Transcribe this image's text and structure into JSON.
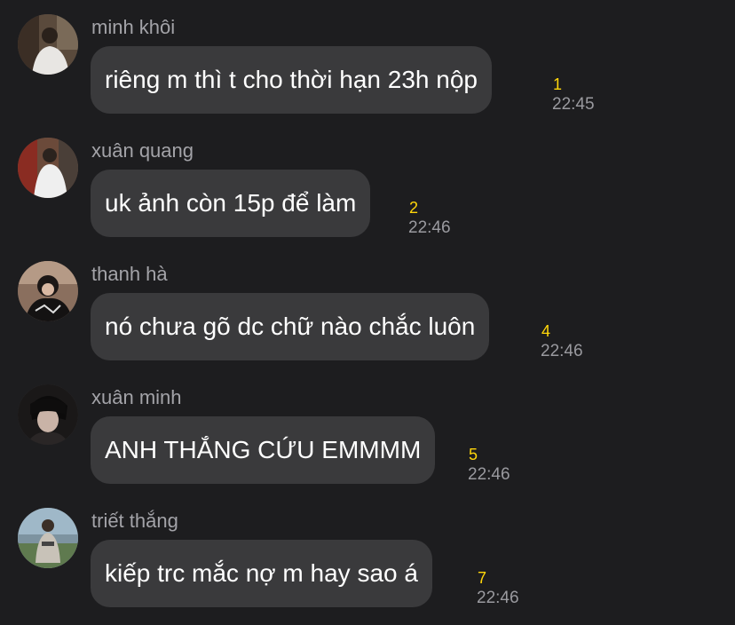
{
  "colors": {
    "background": "#1d1d1f",
    "bubble": "#3a3a3c",
    "sender_name": "#a3a3a8",
    "message_text": "#ffffff",
    "count_badge": "#ffd60a",
    "timestamp": "#9a9a9f"
  },
  "messages": [
    {
      "sender": "minh khôi",
      "text": "riêng m thì t cho thời hạn 23h nộp",
      "count": "1",
      "time": "22:45",
      "avatar_icon": "user-photo-avatar"
    },
    {
      "sender": "xuân quang",
      "text": "uk ảnh còn 15p để làm",
      "count": "2",
      "time": "22:46",
      "avatar_icon": "user-photo-avatar"
    },
    {
      "sender": "thanh hà",
      "text": "nó chưa gõ dc chữ nào chắc luôn",
      "count": "4",
      "time": "22:46",
      "avatar_icon": "user-photo-avatar"
    },
    {
      "sender": "xuân minh",
      "text": "ANH THẮNG CỨU EMMMM",
      "count": "5",
      "time": "22:46",
      "avatar_icon": "user-photo-avatar"
    },
    {
      "sender": "triết thắng",
      "text": "kiếp trc mắc nợ m hay sao á",
      "count": "7",
      "time": "22:46",
      "avatar_icon": "user-photo-avatar"
    }
  ]
}
